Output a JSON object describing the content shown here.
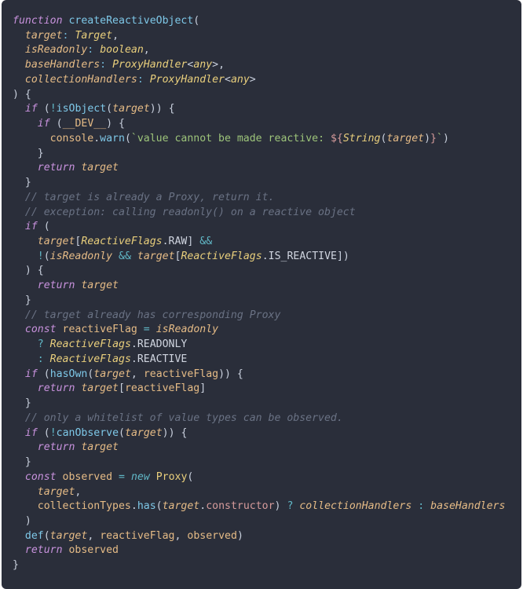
{
  "code": {
    "fn": "function",
    "fnName": "createReactiveObject",
    "p_target": "target",
    "t_Target": "Target",
    "p_isReadonly": "isReadonly",
    "t_boolean": "boolean",
    "p_baseHandlers": "baseHandlers",
    "t_ProxyHandler": "ProxyHandler",
    "t_any": "any",
    "p_collectionHandlers": "collectionHandlers",
    "k_if": "if",
    "k_return": "return",
    "k_const": "const",
    "k_new": "new",
    "fn_isObject": "isObject",
    "v_DEV": "__DEV__",
    "o_console": "console",
    "m_warn": "warn",
    "str_pre": "`value cannot be made reactive: ",
    "fn_String": "String",
    "str_post": "`",
    "c1": "// target is already a Proxy, return it.",
    "c2": "// exception: calling readonly() on a reactive object",
    "cls_ReactiveFlags": "ReactiveFlags",
    "const_RAW": "RAW",
    "const_IS_REACTIVE": "IS_REACTIVE",
    "c3": "// target already has corresponding Proxy",
    "v_reactiveFlag": "reactiveFlag",
    "const_READONLY": "READONLY",
    "const_REACTIVE": "REACTIVE",
    "fn_hasOwn": "hasOwn",
    "c4": "// only a whitelist of value types can be observed.",
    "fn_canObserve": "canObserve",
    "v_observed": "observed",
    "cls_Proxy": "Proxy",
    "v_collectionTypes": "collectionTypes",
    "m_has": "has",
    "p_constructor": "constructor",
    "fn_def": "def"
  }
}
